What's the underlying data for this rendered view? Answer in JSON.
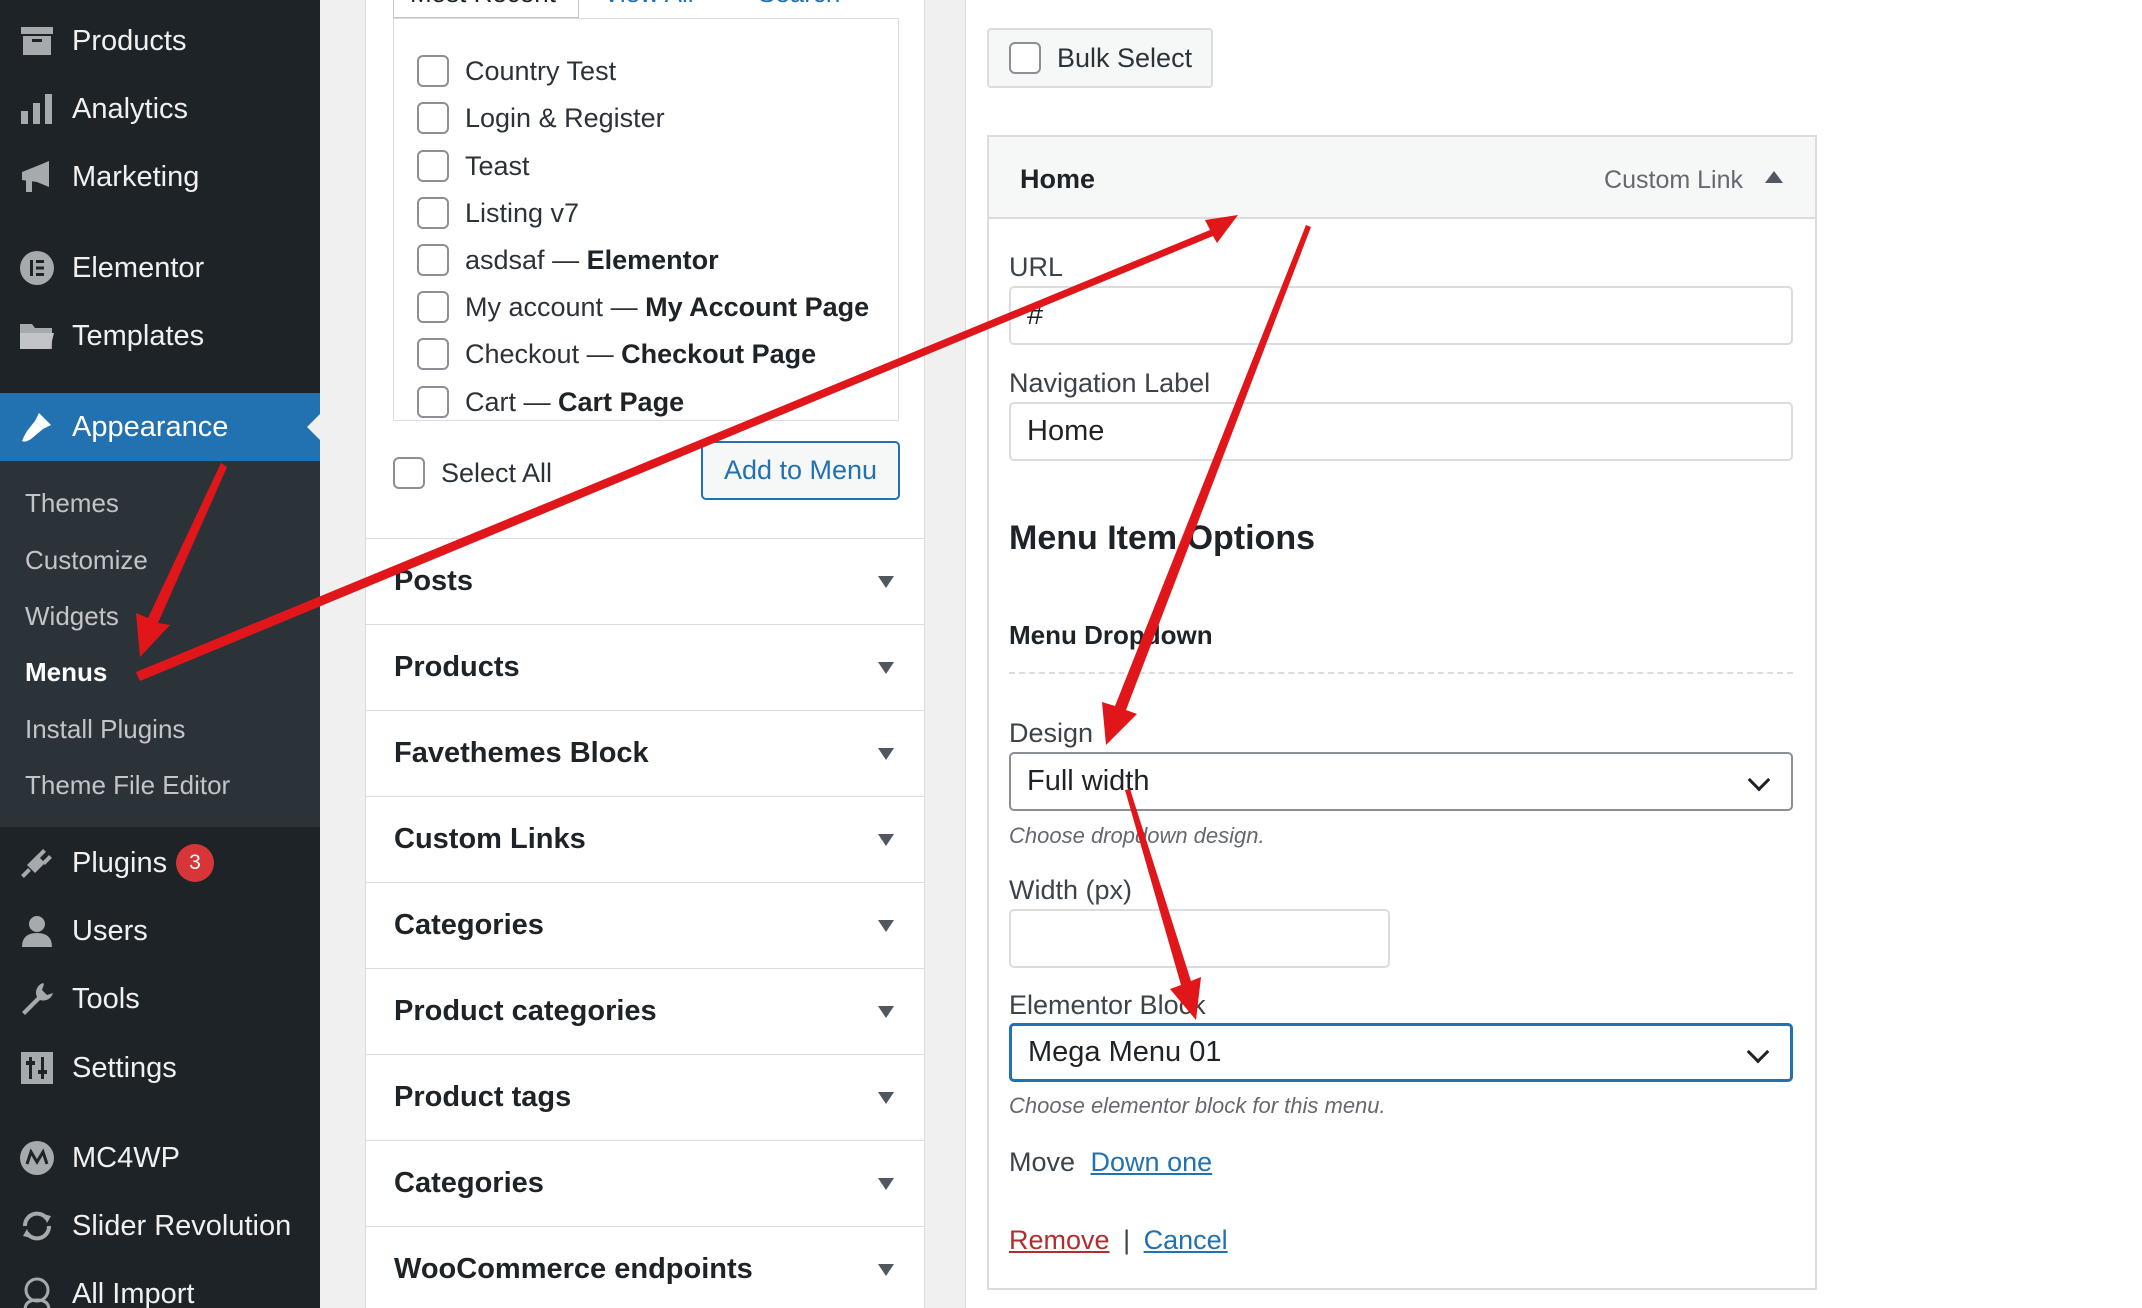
{
  "sidebar": {
    "items": [
      {
        "label": "Products",
        "icon": "archive-icon"
      },
      {
        "label": "Analytics",
        "icon": "bar-chart-icon"
      },
      {
        "label": "Marketing",
        "icon": "megaphone-icon"
      },
      {
        "label": "Elementor",
        "icon": "elementor-icon"
      },
      {
        "label": "Templates",
        "icon": "folder-icon"
      },
      {
        "label": "Appearance",
        "icon": "paintbrush-icon"
      },
      {
        "label": "Plugins",
        "icon": "plug-icon"
      },
      {
        "label": "Users",
        "icon": "user-icon"
      },
      {
        "label": "Tools",
        "icon": "wrench-icon"
      },
      {
        "label": "Settings",
        "icon": "settings-icon"
      },
      {
        "label": "MC4WP",
        "icon": "mc4wp-icon"
      },
      {
        "label": "Slider Revolution",
        "icon": "refresh-icon"
      },
      {
        "label": "All Import",
        "icon": "import-icon"
      }
    ],
    "appearance_submenu": [
      "Themes",
      "Customize",
      "Widgets",
      "Menus",
      "Install Plugins",
      "Theme File Editor"
    ],
    "plugins_badge": "3",
    "accent_color": "#2271b1",
    "background_color": "#1d2327"
  },
  "pages_box": {
    "tabs": [
      "Most Recent",
      "View All",
      "Search"
    ],
    "items": [
      {
        "title": "Country Test",
        "state": ""
      },
      {
        "title": "Login & Register",
        "state": ""
      },
      {
        "title": "Teast",
        "state": ""
      },
      {
        "title": "Listing v7",
        "state": ""
      },
      {
        "title": "asdsaf",
        "state": "Elementor"
      },
      {
        "title": "My account",
        "state": "My Account Page"
      },
      {
        "title": "Checkout",
        "state": "Checkout Page"
      },
      {
        "title": "Cart",
        "state": "Cart Page"
      }
    ],
    "separator": " — ",
    "select_all_label": "Select All",
    "add_button_label": "Add to Menu"
  },
  "accordions": [
    "Posts",
    "Products",
    "Favethemes Block",
    "Custom Links",
    "Categories",
    "Product categories",
    "Product tags",
    "Categories",
    "WooCommerce endpoints"
  ],
  "structure": {
    "bulk_select_label": "Bulk Select",
    "item": {
      "title": "Home",
      "type": "Custom Link",
      "url_label": "URL",
      "url_value": "#",
      "nav_label_label": "Navigation Label",
      "nav_label_value": "Home",
      "options_heading": "Menu Item Options",
      "dropdown_heading": "Menu Dropdown",
      "design_label": "Design",
      "design_value": "Full width",
      "design_hint": "Choose dropdown design.",
      "width_label": "Width (px)",
      "width_value": "",
      "block_label": "Elementor Block",
      "block_value": "Mega Menu 01",
      "block_hint": "Choose elementor block for this menu.",
      "move_label": "Move",
      "move_link": "Down one",
      "remove_label": "Remove",
      "actions_separator": "|",
      "cancel_label": "Cancel"
    }
  },
  "annotation_color": "#e0161b"
}
